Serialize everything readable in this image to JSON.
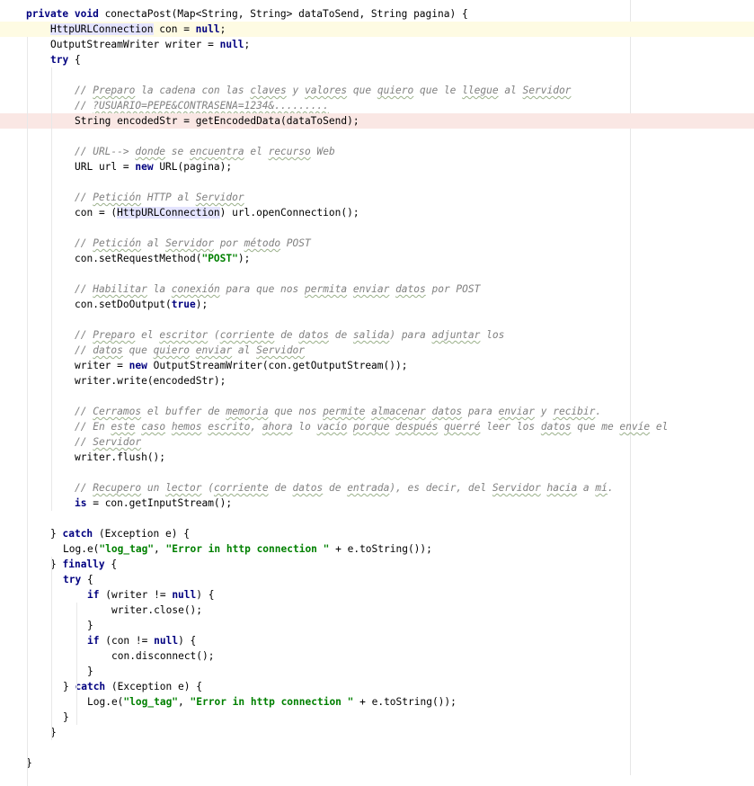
{
  "editor": {
    "lines": [
      {
        "indent": 4,
        "spans": [
          {
            "t": "private void ",
            "k": "kw"
          },
          {
            "t": "conectaPost(Map<String, String> dataToSend, String pagina) {"
          }
        ]
      },
      {
        "indent": 8,
        "hl": "caret",
        "spans": [
          {
            "t": "HttpURLConnection",
            "k": "hl-id"
          },
          {
            "t": " con = "
          },
          {
            "t": "null",
            "k": "kw"
          },
          {
            "t": ";"
          }
        ]
      },
      {
        "indent": 8,
        "spans": [
          {
            "t": "OutputStreamWriter writer = "
          },
          {
            "t": "null",
            "k": "kw"
          },
          {
            "t": ";"
          }
        ]
      },
      {
        "indent": 8,
        "spans": [
          {
            "t": "try",
            "k": "kw"
          },
          {
            "t": " {"
          }
        ]
      },
      {
        "indent": 0,
        "spans": []
      },
      {
        "indent": 12,
        "spans": [
          {
            "t": "// ",
            "k": "cmt"
          },
          {
            "t": "Preparo",
            "k": "cmt typo"
          },
          {
            "t": " la cadena con las ",
            "k": "cmt"
          },
          {
            "t": "claves",
            "k": "cmt typo"
          },
          {
            "t": " y ",
            "k": "cmt"
          },
          {
            "t": "valores",
            "k": "cmt typo"
          },
          {
            "t": " que ",
            "k": "cmt"
          },
          {
            "t": "quiero",
            "k": "cmt typo"
          },
          {
            "t": " que le ",
            "k": "cmt"
          },
          {
            "t": "llegue",
            "k": "cmt typo"
          },
          {
            "t": " al ",
            "k": "cmt"
          },
          {
            "t": "Servidor",
            "k": "cmt typo"
          }
        ]
      },
      {
        "indent": 12,
        "spans": [
          {
            "t": "// ",
            "k": "cmt"
          },
          {
            "t": "?USUARIO=PEPE&CONTRASENA=1234&.........",
            "k": "cmt typo"
          }
        ]
      },
      {
        "indent": 12,
        "hl": "error",
        "spans": [
          {
            "t": "String encodedStr = getEncodedData(dataToSend);"
          }
        ]
      },
      {
        "indent": 0,
        "spans": []
      },
      {
        "indent": 12,
        "spans": [
          {
            "t": "// URL--> ",
            "k": "cmt"
          },
          {
            "t": "donde",
            "k": "cmt typo"
          },
          {
            "t": " se ",
            "k": "cmt"
          },
          {
            "t": "encuentra",
            "k": "cmt typo"
          },
          {
            "t": " el ",
            "k": "cmt"
          },
          {
            "t": "recurso",
            "k": "cmt typo"
          },
          {
            "t": " Web",
            "k": "cmt"
          }
        ]
      },
      {
        "indent": 12,
        "spans": [
          {
            "t": "URL url = "
          },
          {
            "t": "new",
            "k": "kw"
          },
          {
            "t": " URL(pagina);"
          }
        ]
      },
      {
        "indent": 0,
        "spans": []
      },
      {
        "indent": 12,
        "spans": [
          {
            "t": "// ",
            "k": "cmt"
          },
          {
            "t": "Petición",
            "k": "cmt typo"
          },
          {
            "t": " HTTP al ",
            "k": "cmt"
          },
          {
            "t": "Servidor",
            "k": "cmt typo"
          }
        ]
      },
      {
        "indent": 12,
        "spans": [
          {
            "t": "con = ("
          },
          {
            "t": "HttpURLConnection",
            "k": "hl-id2"
          },
          {
            "t": ") url.openConnection();"
          }
        ]
      },
      {
        "indent": 0,
        "spans": []
      },
      {
        "indent": 12,
        "spans": [
          {
            "t": "// ",
            "k": "cmt"
          },
          {
            "t": "Petición",
            "k": "cmt typo"
          },
          {
            "t": " al ",
            "k": "cmt"
          },
          {
            "t": "Servidor",
            "k": "cmt typo"
          },
          {
            "t": " por ",
            "k": "cmt"
          },
          {
            "t": "método",
            "k": "cmt typo"
          },
          {
            "t": " POST",
            "k": "cmt"
          }
        ]
      },
      {
        "indent": 12,
        "spans": [
          {
            "t": "con.setRequestMethod("
          },
          {
            "t": "\"POST\"",
            "k": "str"
          },
          {
            "t": ");"
          }
        ]
      },
      {
        "indent": 0,
        "spans": []
      },
      {
        "indent": 12,
        "spans": [
          {
            "t": "// ",
            "k": "cmt"
          },
          {
            "t": "Habilitar",
            "k": "cmt typo"
          },
          {
            "t": " la ",
            "k": "cmt"
          },
          {
            "t": "conexión",
            "k": "cmt typo"
          },
          {
            "t": " para que nos ",
            "k": "cmt"
          },
          {
            "t": "permita",
            "k": "cmt typo"
          },
          {
            "t": " ",
            "k": "cmt"
          },
          {
            "t": "enviar",
            "k": "cmt typo"
          },
          {
            "t": " ",
            "k": "cmt"
          },
          {
            "t": "datos",
            "k": "cmt typo"
          },
          {
            "t": " por POST",
            "k": "cmt"
          }
        ]
      },
      {
        "indent": 12,
        "spans": [
          {
            "t": "con.setDoOutput("
          },
          {
            "t": "true",
            "k": "kw"
          },
          {
            "t": ");"
          }
        ]
      },
      {
        "indent": 0,
        "spans": []
      },
      {
        "indent": 12,
        "spans": [
          {
            "t": "// ",
            "k": "cmt"
          },
          {
            "t": "Preparo",
            "k": "cmt typo"
          },
          {
            "t": " el ",
            "k": "cmt"
          },
          {
            "t": "escritor",
            "k": "cmt typo"
          },
          {
            "t": " (",
            "k": "cmt"
          },
          {
            "t": "corriente",
            "k": "cmt typo"
          },
          {
            "t": " de ",
            "k": "cmt"
          },
          {
            "t": "datos",
            "k": "cmt typo"
          },
          {
            "t": " de ",
            "k": "cmt"
          },
          {
            "t": "salida",
            "k": "cmt typo"
          },
          {
            "t": ") para ",
            "k": "cmt"
          },
          {
            "t": "adjuntar",
            "k": "cmt typo"
          },
          {
            "t": " los",
            "k": "cmt"
          }
        ]
      },
      {
        "indent": 12,
        "spans": [
          {
            "t": "// ",
            "k": "cmt"
          },
          {
            "t": "datos",
            "k": "cmt typo"
          },
          {
            "t": " que ",
            "k": "cmt"
          },
          {
            "t": "quiero",
            "k": "cmt typo"
          },
          {
            "t": " ",
            "k": "cmt"
          },
          {
            "t": "enviar",
            "k": "cmt typo"
          },
          {
            "t": " al ",
            "k": "cmt"
          },
          {
            "t": "Servidor",
            "k": "cmt typo"
          }
        ]
      },
      {
        "indent": 12,
        "spans": [
          {
            "t": "writer = "
          },
          {
            "t": "new",
            "k": "kw"
          },
          {
            "t": " OutputStreamWriter(con.getOutputStream());"
          }
        ]
      },
      {
        "indent": 12,
        "spans": [
          {
            "t": "writer.write(encodedStr);"
          }
        ]
      },
      {
        "indent": 0,
        "spans": []
      },
      {
        "indent": 12,
        "spans": [
          {
            "t": "// ",
            "k": "cmt"
          },
          {
            "t": "Cerramos",
            "k": "cmt typo"
          },
          {
            "t": " el buffer de ",
            "k": "cmt"
          },
          {
            "t": "memoria",
            "k": "cmt typo"
          },
          {
            "t": " que nos ",
            "k": "cmt"
          },
          {
            "t": "permite",
            "k": "cmt typo"
          },
          {
            "t": " ",
            "k": "cmt"
          },
          {
            "t": "almacenar",
            "k": "cmt typo"
          },
          {
            "t": " ",
            "k": "cmt"
          },
          {
            "t": "datos",
            "k": "cmt typo"
          },
          {
            "t": " para ",
            "k": "cmt"
          },
          {
            "t": "enviar",
            "k": "cmt typo"
          },
          {
            "t": " y ",
            "k": "cmt"
          },
          {
            "t": "recibir",
            "k": "cmt typo"
          },
          {
            "t": ".",
            "k": "cmt"
          }
        ]
      },
      {
        "indent": 12,
        "spans": [
          {
            "t": "// En ",
            "k": "cmt"
          },
          {
            "t": "este",
            "k": "cmt typo"
          },
          {
            "t": " ",
            "k": "cmt"
          },
          {
            "t": "caso",
            "k": "cmt typo"
          },
          {
            "t": " ",
            "k": "cmt"
          },
          {
            "t": "hemos",
            "k": "cmt typo"
          },
          {
            "t": " ",
            "k": "cmt"
          },
          {
            "t": "escrito",
            "k": "cmt typo"
          },
          {
            "t": ", ",
            "k": "cmt"
          },
          {
            "t": "ahora",
            "k": "cmt typo"
          },
          {
            "t": " lo ",
            "k": "cmt"
          },
          {
            "t": "vacío",
            "k": "cmt typo"
          },
          {
            "t": " ",
            "k": "cmt"
          },
          {
            "t": "porque",
            "k": "cmt typo"
          },
          {
            "t": " ",
            "k": "cmt"
          },
          {
            "t": "después",
            "k": "cmt typo"
          },
          {
            "t": " ",
            "k": "cmt"
          },
          {
            "t": "querré",
            "k": "cmt typo"
          },
          {
            "t": " leer los ",
            "k": "cmt"
          },
          {
            "t": "datos",
            "k": "cmt typo"
          },
          {
            "t": " que me ",
            "k": "cmt"
          },
          {
            "t": "envíe",
            "k": "cmt typo"
          },
          {
            "t": " el",
            "k": "cmt"
          }
        ]
      },
      {
        "indent": 12,
        "spans": [
          {
            "t": "// ",
            "k": "cmt"
          },
          {
            "t": "Servidor",
            "k": "cmt typo"
          }
        ]
      },
      {
        "indent": 12,
        "spans": [
          {
            "t": "writer.flush();"
          }
        ]
      },
      {
        "indent": 0,
        "spans": []
      },
      {
        "indent": 12,
        "spans": [
          {
            "t": "// ",
            "k": "cmt"
          },
          {
            "t": "Recupero",
            "k": "cmt typo"
          },
          {
            "t": " un ",
            "k": "cmt"
          },
          {
            "t": "lector",
            "k": "cmt typo"
          },
          {
            "t": " (",
            "k": "cmt"
          },
          {
            "t": "corriente",
            "k": "cmt typo"
          },
          {
            "t": " de ",
            "k": "cmt"
          },
          {
            "t": "datos",
            "k": "cmt typo"
          },
          {
            "t": " de ",
            "k": "cmt"
          },
          {
            "t": "entrada",
            "k": "cmt typo"
          },
          {
            "t": "), es decir, del ",
            "k": "cmt"
          },
          {
            "t": "Servidor",
            "k": "cmt typo"
          },
          {
            "t": " ",
            "k": "cmt"
          },
          {
            "t": "hacia",
            "k": "cmt typo"
          },
          {
            "t": " a ",
            "k": "cmt"
          },
          {
            "t": "mí",
            "k": "cmt typo"
          },
          {
            "t": ".",
            "k": "cmt"
          }
        ]
      },
      {
        "indent": 12,
        "spans": [
          {
            "t": "is",
            "k": "kw"
          },
          {
            "t": " = con.getInputStream();"
          }
        ]
      },
      {
        "indent": 0,
        "spans": []
      },
      {
        "indent": 8,
        "spans": [
          {
            "t": "} "
          },
          {
            "t": "catch",
            "k": "kw"
          },
          {
            "t": " (Exception e) {"
          }
        ]
      },
      {
        "indent": 10,
        "spans": [
          {
            "t": "Log.e("
          },
          {
            "t": "\"log_tag\"",
            "k": "str"
          },
          {
            "t": ", "
          },
          {
            "t": "\"Error in http connection \"",
            "k": "str"
          },
          {
            "t": " + e.toString());"
          }
        ]
      },
      {
        "indent": 8,
        "spans": [
          {
            "t": "} "
          },
          {
            "t": "finally",
            "k": "kw"
          },
          {
            "t": " {"
          }
        ]
      },
      {
        "indent": 10,
        "spans": [
          {
            "t": "try",
            "k": "kw"
          },
          {
            "t": " {"
          }
        ]
      },
      {
        "indent": 14,
        "spans": [
          {
            "t": "if",
            "k": "kw"
          },
          {
            "t": " (writer != "
          },
          {
            "t": "null",
            "k": "kw"
          },
          {
            "t": ") {"
          }
        ]
      },
      {
        "indent": 18,
        "spans": [
          {
            "t": "writer.close();"
          }
        ]
      },
      {
        "indent": 14,
        "spans": [
          {
            "t": "}"
          }
        ]
      },
      {
        "indent": 14,
        "spans": [
          {
            "t": "if",
            "k": "kw"
          },
          {
            "t": " (con != "
          },
          {
            "t": "null",
            "k": "kw"
          },
          {
            "t": ") {"
          }
        ]
      },
      {
        "indent": 18,
        "spans": [
          {
            "t": "con.disconnect();"
          }
        ]
      },
      {
        "indent": 14,
        "spans": [
          {
            "t": "}"
          }
        ]
      },
      {
        "indent": 10,
        "spans": [
          {
            "t": "} "
          },
          {
            "t": "catch",
            "k": "kw"
          },
          {
            "t": " (Exception e) {"
          }
        ]
      },
      {
        "indent": 14,
        "spans": [
          {
            "t": "Log.e("
          },
          {
            "t": "\"log_tag\"",
            "k": "str"
          },
          {
            "t": ", "
          },
          {
            "t": "\"Error in http connection \"",
            "k": "str"
          },
          {
            "t": " + e.toString());"
          }
        ]
      },
      {
        "indent": 10,
        "spans": [
          {
            "t": "}"
          }
        ]
      },
      {
        "indent": 8,
        "spans": [
          {
            "t": "}"
          }
        ]
      },
      {
        "indent": 0,
        "spans": []
      },
      {
        "indent": 4,
        "spans": [
          {
            "t": "}"
          }
        ]
      }
    ]
  },
  "colors": {
    "keyword": "#000080",
    "string": "#008000",
    "comment": "#808080",
    "caret_row": "#fefbe3",
    "error_row": "#fae7e4",
    "identifier_highlight": "#e4e4ff"
  }
}
